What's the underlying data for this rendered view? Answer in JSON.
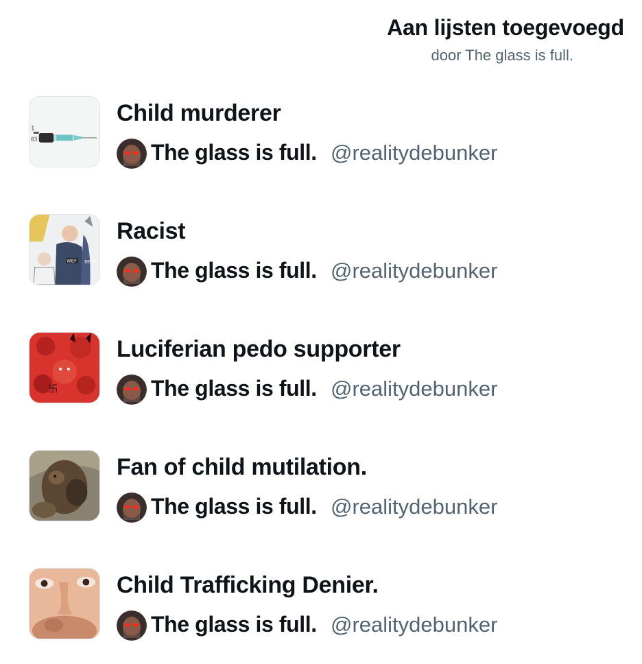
{
  "header": {
    "title": "Aan lijsten toegevoegd",
    "subtitle": "door The glass is full."
  },
  "lists": [
    {
      "name": "Child murderer",
      "owner_name": "The glass is full.",
      "owner_handle": "@realitydebunker",
      "thumbnail_icon": "syringe-image"
    },
    {
      "name": "Racist",
      "owner_name": "The glass is full.",
      "owner_handle": "@realitydebunker",
      "thumbnail_icon": "political-cartoon-image"
    },
    {
      "name": "Luciferian pedo supporter",
      "owner_name": "The glass is full.",
      "owner_handle": "@realitydebunker",
      "thumbnail_icon": "red-demons-image"
    },
    {
      "name": "Fan of child mutilation.",
      "owner_name": "The glass is full.",
      "owner_handle": "@realitydebunker",
      "thumbnail_icon": "creature-image"
    },
    {
      "name": "Child Trafficking Denier.",
      "owner_name": "The glass is full.",
      "owner_handle": "@realitydebunker",
      "thumbnail_icon": "child-face-image"
    }
  ],
  "colors": {
    "text_primary": "#0f1419",
    "text_secondary": "#536471",
    "background": "#ffffff"
  }
}
